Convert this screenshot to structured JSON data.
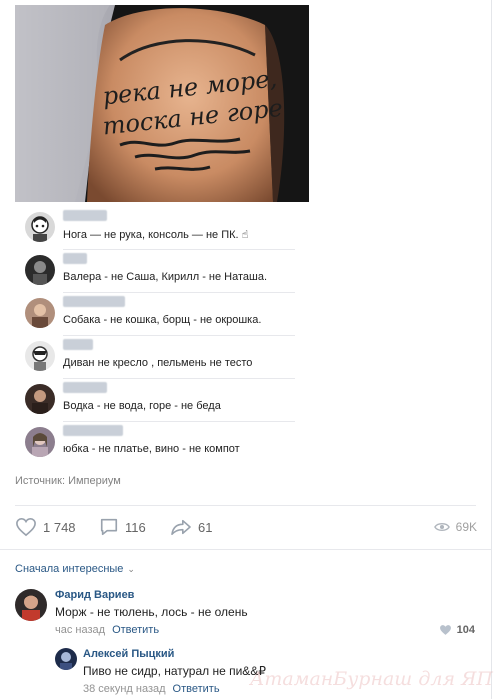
{
  "post": {
    "photo": {
      "icon": "tattoo-photo",
      "tattoo_line1": "река не море,",
      "tattoo_line2": "тоска не горе"
    },
    "inner_comments": [
      {
        "text": "Нога — не рука, консоль — не ПК. ☝",
        "name_width": 44
      },
      {
        "text": "Валера - не Саша, Кирилл - не Наташа.",
        "name_width": 24
      },
      {
        "text": "Собака - не кошка, борщ - не окрошка.",
        "name_width": 62
      },
      {
        "text": "Диван не кресло , пельмень не тесто",
        "name_width": 30
      },
      {
        "text": "Водка - не вода, горе - не беда",
        "name_width": 44
      },
      {
        "text": "юбка - не платье, вино - не компот",
        "name_width": 60
      }
    ],
    "source": "Источник: Империум",
    "actions": {
      "likes": "1 748",
      "comments": "116",
      "shares": "61",
      "views": "69K"
    }
  },
  "comments_section": {
    "sort_label": "Сначала интересные",
    "comments": [
      {
        "author": "Фарид Вариев",
        "text": "Морж - не тюлень, лось - не олень",
        "time": "час назад",
        "reply_label": "Ответить",
        "likes": "104"
      }
    ],
    "replies": [
      {
        "author": "Алексей Пыцкий",
        "text": "Пиво не сидр, натурал не пи&&₽",
        "time": "38 секунд назад",
        "reply_label": "Ответить"
      }
    ]
  },
  "watermark": "АтаманБурнаш для ЯП",
  "colors": {
    "link": "#2a5885",
    "muted": "#828282",
    "divider": "#e7e8ec"
  }
}
